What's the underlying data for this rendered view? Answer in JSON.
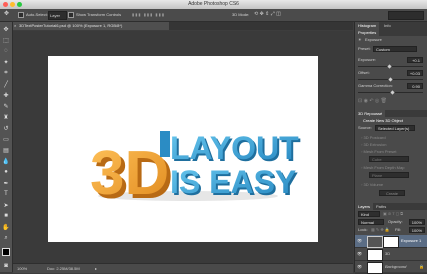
{
  "window": {
    "title": "Adobe Photoshop CS6",
    "traffic_colors": [
      "#ff5f57",
      "#ffbd2e",
      "#28c940"
    ]
  },
  "options_bar": {
    "auto_select_label": "Auto-Select:",
    "auto_select_value": "Layer",
    "show_transform_label": "Show Transform Controls",
    "mode_label": "3D Mode:"
  },
  "document": {
    "tab_label": "3DTextPosterTutorial6.psd @ 100% (Exposure 1, RGB/8*)",
    "zoom": "100%",
    "doc_info": "Doc: 2.25M/38.5M"
  },
  "canvas_art": {
    "big_3d": "3D",
    "line1": "LAYOUT",
    "line2": "IS EASY",
    "orange": "#f5a23a",
    "blue": "#3ea9dc"
  },
  "properties_panel": {
    "tabs": [
      "Histogram",
      "Info"
    ],
    "header": "Properties",
    "layer_type": "Exposure",
    "preset_label": "Preset:",
    "preset_value": "Custom",
    "exposure_label": "Exposure:",
    "exposure_value": "+0.1",
    "offset_label": "Offset:",
    "offset_value": "+0.03",
    "gamma_label": "Gamma Correction:",
    "gamma_value": "0.90"
  },
  "repousse_panel": {
    "header": "3D Repoussé",
    "create_label": "Create New 3D Object",
    "source_label": "Source:",
    "source_value": "Selected Layer(s)",
    "options": [
      "3D Postcard",
      "3D Extrusion",
      "Mesh From Preset",
      "Mesh From Depth Map",
      "3D Volume"
    ],
    "mesh_preset_value": "Cube",
    "depth_value": "Plane",
    "create_button": "Create"
  },
  "layers_panel": {
    "tabs": [
      "Layers",
      "Paths"
    ],
    "kind_label": "Kind",
    "blend_mode": "Normal",
    "opacity_label": "Opacity:",
    "opacity_value": "100%",
    "lock_label": "Lock:",
    "fill_label": "Fill:",
    "fill_value": "100%",
    "layers": [
      {
        "name": "Exposure 1",
        "selected": true
      },
      {
        "name": "3D",
        "selected": false
      },
      {
        "name": "Background",
        "selected": false
      }
    ]
  },
  "tools": [
    "move-icon",
    "marquee-icon",
    "lasso-icon",
    "magic-wand-icon",
    "crop-icon",
    "eyedropper-icon",
    "healing-icon",
    "brush-icon",
    "clone-stamp-icon",
    "history-brush-icon",
    "eraser-icon",
    "gradient-icon",
    "blur-icon",
    "dodge-icon",
    "pen-icon",
    "type-icon",
    "path-select-icon",
    "shape-icon",
    "hand-icon",
    "zoom-icon"
  ]
}
